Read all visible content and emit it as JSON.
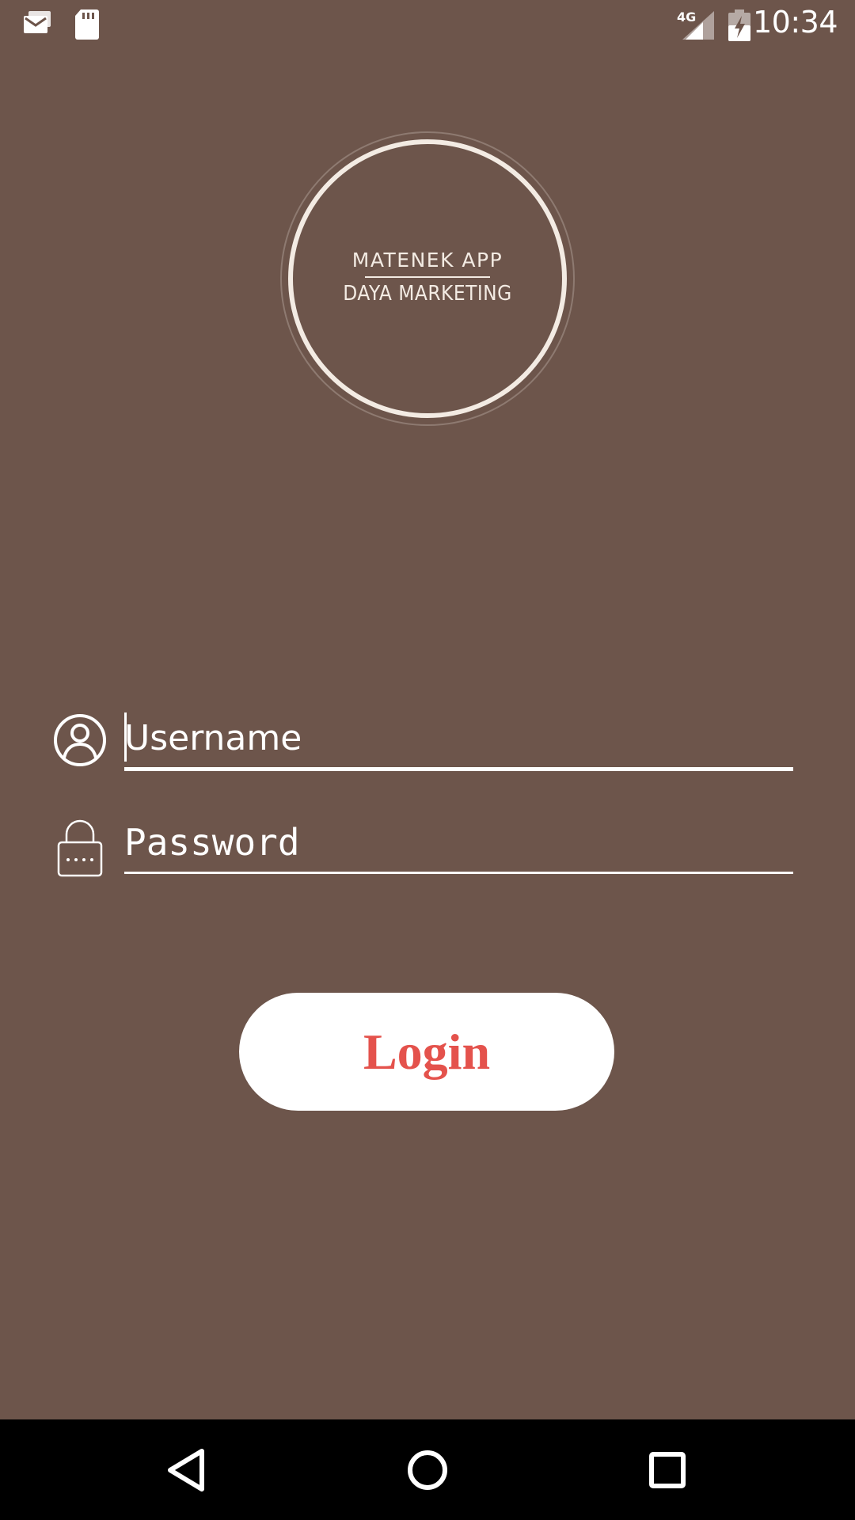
{
  "status_bar": {
    "time": "10:34",
    "network": "4G",
    "icons": [
      "email-notification-icon",
      "sd-card-icon",
      "signal-icon",
      "battery-charging-icon"
    ]
  },
  "logo": {
    "line1": "MATENEK APP",
    "line2": "DAYA MARKETING"
  },
  "form": {
    "username": {
      "placeholder": "Username",
      "value": "",
      "icon": "user-circle-icon"
    },
    "password": {
      "placeholder": "Password",
      "value": "",
      "icon": "lock-icon"
    }
  },
  "login_button": {
    "label": "Login"
  },
  "nav_bar": {
    "buttons": [
      "back-icon",
      "home-icon",
      "recents-icon"
    ]
  },
  "colors": {
    "background": "#6d554b",
    "logo_ring": "#f3ebe3",
    "button_text": "#e4524c",
    "button_bg": "#ffffff",
    "nav_bar": "#000000"
  }
}
